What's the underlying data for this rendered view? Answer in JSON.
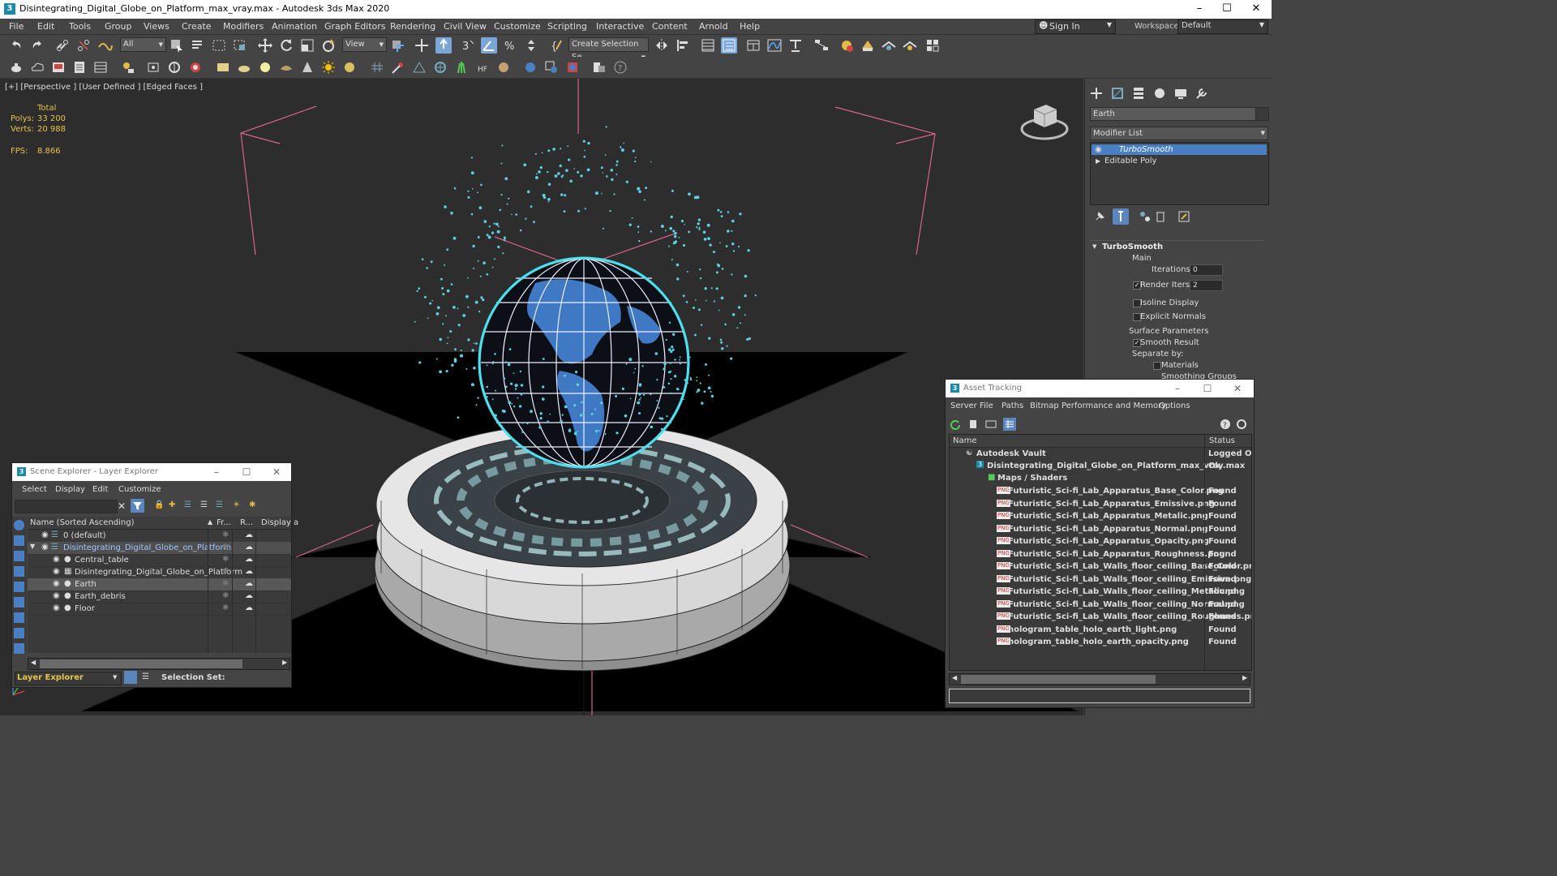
{
  "window": {
    "title": "Disintegrating_Digital_Globe_on_Platform_max_vray.max - Autodesk 3ds Max 2020",
    "app_icon": "3",
    "minimize": "–",
    "maximize": "☐",
    "close": "✕"
  },
  "menu": {
    "items": [
      "File",
      "Edit",
      "Tools",
      "Group",
      "Views",
      "Create",
      "Modifiers",
      "Animation",
      "Graph Editors",
      "Rendering",
      "Civil View",
      "Customize",
      "Scripting",
      "Interactive",
      "Content",
      "Arnold",
      "Help"
    ],
    "sign_in": "Sign In",
    "workspaces_label": "Workspaces:",
    "workspaces_value": "Default"
  },
  "toolbar": {
    "selection_filter": "All",
    "ref_coord": "View",
    "named_selection": "Create Selection Se"
  },
  "viewport": {
    "label": "[+] [Perspective ] [User Defined ] [Edged Faces ]",
    "stats": {
      "total_label": "Total",
      "polys_label": "Polys:",
      "polys_value": "33 200",
      "verts_label": "Verts:",
      "verts_value": "20 988",
      "fps_label": "FPS:",
      "fps_value": "8.866"
    }
  },
  "command_panel": {
    "object_name": "Earth",
    "modifier_list": "Modifier List",
    "stack": [
      "TurboSmooth",
      "Editable Poly"
    ],
    "turbosmooth": {
      "title": "TurboSmooth",
      "main_label": "Main",
      "iterations_label": "Iterations:",
      "iterations_value": "0",
      "render_iters_label": "Render Iters:",
      "render_iters_value": "2",
      "isoline_label": "Isoline Display",
      "explicit_normals_label": "Explicit Normals",
      "surface_label": "Surface Parameters",
      "smooth_result_label": "Smooth Result",
      "separate_by_label": "Separate by:",
      "materials_label": "Materials",
      "smoothing_groups_label": "Smoothing Groups"
    }
  },
  "scene_explorer": {
    "title": "Scene Explorer - Layer Explorer",
    "menu": [
      "Select",
      "Display",
      "Edit",
      "Customize"
    ],
    "columns": {
      "name": "Name (Sorted Ascending)",
      "frozen": "Fr...",
      "render": "R...",
      "display": "Display a"
    },
    "rows": [
      {
        "label": "0 (default)"
      },
      {
        "label": "Disintegrating_Digital_Globe_on_Platform"
      },
      {
        "label": "Central_table"
      },
      {
        "label": "Disintegrating_Digital_Globe_on_Platform"
      },
      {
        "label": "Earth"
      },
      {
        "label": "Earth_debris"
      },
      {
        "label": "Floor"
      }
    ],
    "footer_explorer": "Layer Explorer",
    "selection_set_label": "Selection Set:"
  },
  "asset_tracking": {
    "title": "Asset Tracking",
    "menu": [
      "Server",
      "File",
      "Paths",
      "Bitmap Performance and Memory",
      "Options"
    ],
    "columns": {
      "name": "Name",
      "status": "Status"
    },
    "vault": {
      "name": "Autodesk Vault",
      "status": "Logged Out"
    },
    "file": {
      "name": "Disintegrating_Digital_Globe_on_Platform_max_vray.max",
      "status": "Ok"
    },
    "maps_label": "Maps / Shaders",
    "maps": [
      {
        "name": "Futuristic_Sci-fi_Lab_Apparatus_Base_Color.png",
        "status": "Found"
      },
      {
        "name": "Futuristic_Sci-fi_Lab_Apparatus_Emissive.png",
        "status": "Found"
      },
      {
        "name": "Futuristic_Sci-fi_Lab_Apparatus_Metalic.png",
        "status": "Found"
      },
      {
        "name": "Futuristic_Sci-fi_Lab_Apparatus_Normal.png",
        "status": "Found"
      },
      {
        "name": "Futuristic_Sci-fi_Lab_Apparatus_Opacity.png",
        "status": "Found"
      },
      {
        "name": "Futuristic_Sci-fi_Lab_Apparatus_Roughness.png",
        "status": "Found"
      },
      {
        "name": "Futuristic_Sci-fi_Lab_Walls_floor_ceiling_Base_Color.png",
        "status": "Found"
      },
      {
        "name": "Futuristic_Sci-fi_Lab_Walls_floor_ceiling_Emissive.png",
        "status": "Found"
      },
      {
        "name": "Futuristic_Sci-fi_Lab_Walls_floor_ceiling_Metalic.png",
        "status": "Found"
      },
      {
        "name": "Futuristic_Sci-fi_Lab_Walls_floor_ceiling_Normal.png",
        "status": "Found"
      },
      {
        "name": "Futuristic_Sci-fi_Lab_Walls_floor_ceiling_Roughness.png",
        "status": "Found"
      },
      {
        "name": "hologram_table_holo_earth_light.png",
        "status": "Found"
      },
      {
        "name": "hologram_table_holo_earth_opacity.png",
        "status": "Found"
      }
    ]
  },
  "colors": {
    "selection_blue": "#4a7fc4",
    "stats_yellow": "#e8c34a",
    "viewport_bg": "#2d2d2d"
  }
}
